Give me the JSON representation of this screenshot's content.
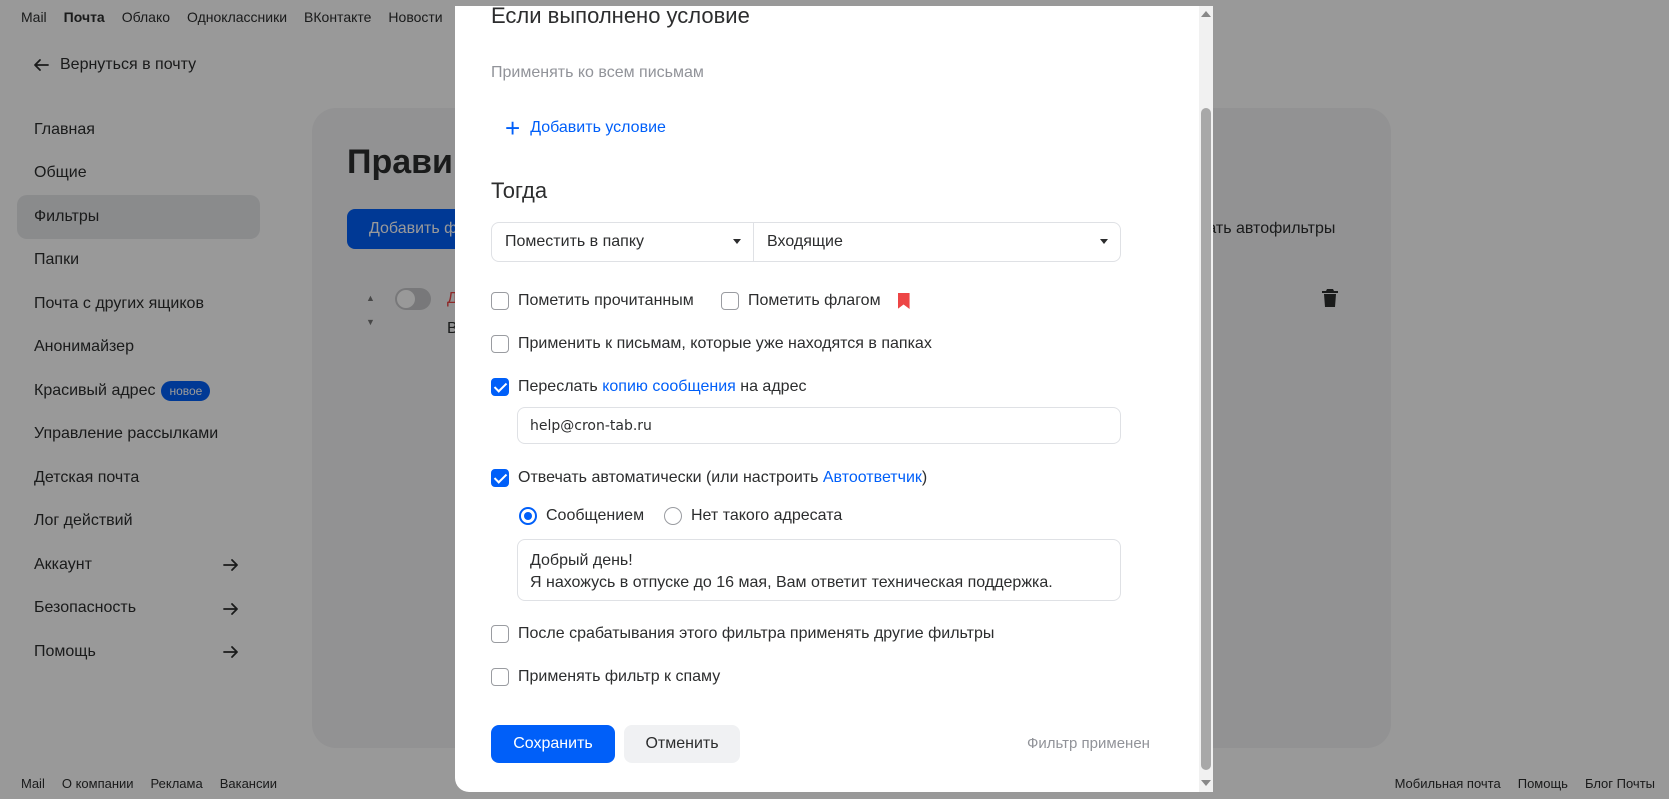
{
  "topnav": [
    "Mail",
    "Почта",
    "Облако",
    "Одноклассники",
    "ВКонтакте",
    "Новости"
  ],
  "back_label": "Вернуться в почту",
  "menu": {
    "items": [
      "Главная",
      "Общие",
      "Фильтры",
      "Папки",
      "Почта с других ящиков",
      "Анонимайзер",
      "Красивый адрес",
      "Управление рассылками",
      "Детская почта",
      "Лог действий",
      "Аккаунт",
      "Безопасность",
      "Помощь"
    ],
    "badge": "новое"
  },
  "page": {
    "title": "Прави",
    "add_button": "Добавить ф",
    "autofilters": "зать автофильтры",
    "rule_first_letter": "Д",
    "rule_second_letter": "В"
  },
  "footer": {
    "left": [
      "Mail",
      "О компании",
      "Реклама",
      "Вакансии"
    ],
    "right": [
      "Мобильная почта",
      "Помощь",
      "Блог Почты"
    ]
  },
  "modal": {
    "condition_heading": "Если выполнено условие",
    "apply_all": "Применять ко всем письмам",
    "add_condition": "Добавить условие",
    "then_heading": "Тогда",
    "action_select": "Поместить в папку",
    "folder_select": "Входящие",
    "mark_read": "Пометить прочитанным",
    "mark_flag": "Пометить флагом",
    "apply_existing": "Применить к письмам, которые уже находятся в папках",
    "forward_prefix": "Переслать",
    "forward_link": "копию сообщения",
    "forward_suffix": "на адрес",
    "forward_email": "help@cron-tab.ru",
    "autoreply_prefix": "Отвечать автоматически (или настроить",
    "autoreply_link": "Автоответчик",
    "autoreply_suffix": ")",
    "radio_message": "Сообщением",
    "radio_no_address": "Нет такого адресата",
    "reply_line1": "Добрый день!",
    "reply_line2": "Я нахожусь в отпуске до 16 мая, Вам ответит техническая поддержка.",
    "after_filter": "После срабатывания этого фильтра применять другие фильтры",
    "apply_spam": "Применять фильтр к спаму",
    "save": "Сохранить",
    "cancel": "Отменить",
    "status": "Фильтр применен"
  },
  "colors": {
    "accent": "#005ff9",
    "flag": "#ed4545",
    "muted": "#919399"
  }
}
